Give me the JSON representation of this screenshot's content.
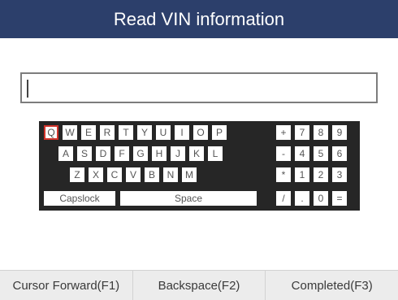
{
  "header": {
    "title": "Read VIN information"
  },
  "vin_input": {
    "value": ""
  },
  "keyboard": {
    "row1": [
      "Q",
      "W",
      "E",
      "R",
      "T",
      "Y",
      "U",
      "I",
      "O",
      "P"
    ],
    "row2": [
      "A",
      "S",
      "D",
      "F",
      "G",
      "H",
      "J",
      "K",
      "L"
    ],
    "row3": [
      "Z",
      "X",
      "C",
      "V",
      "B",
      "N",
      "M"
    ],
    "capslock_label": "Capslock",
    "space_label": "Space",
    "selected_key": "Q",
    "pad_row1": [
      "+",
      "7",
      "8",
      "9"
    ],
    "pad_row2": [
      "-",
      "4",
      "5",
      "6"
    ],
    "pad_row3": [
      "*",
      "1",
      "2",
      "3"
    ],
    "pad_row4": [
      "/",
      ".",
      "0",
      "="
    ]
  },
  "footer": {
    "cursor_forward_label": "Cursor Forward(F1)",
    "backspace_label": "Backspace(F2)",
    "completed_label": "Completed(F3)"
  }
}
